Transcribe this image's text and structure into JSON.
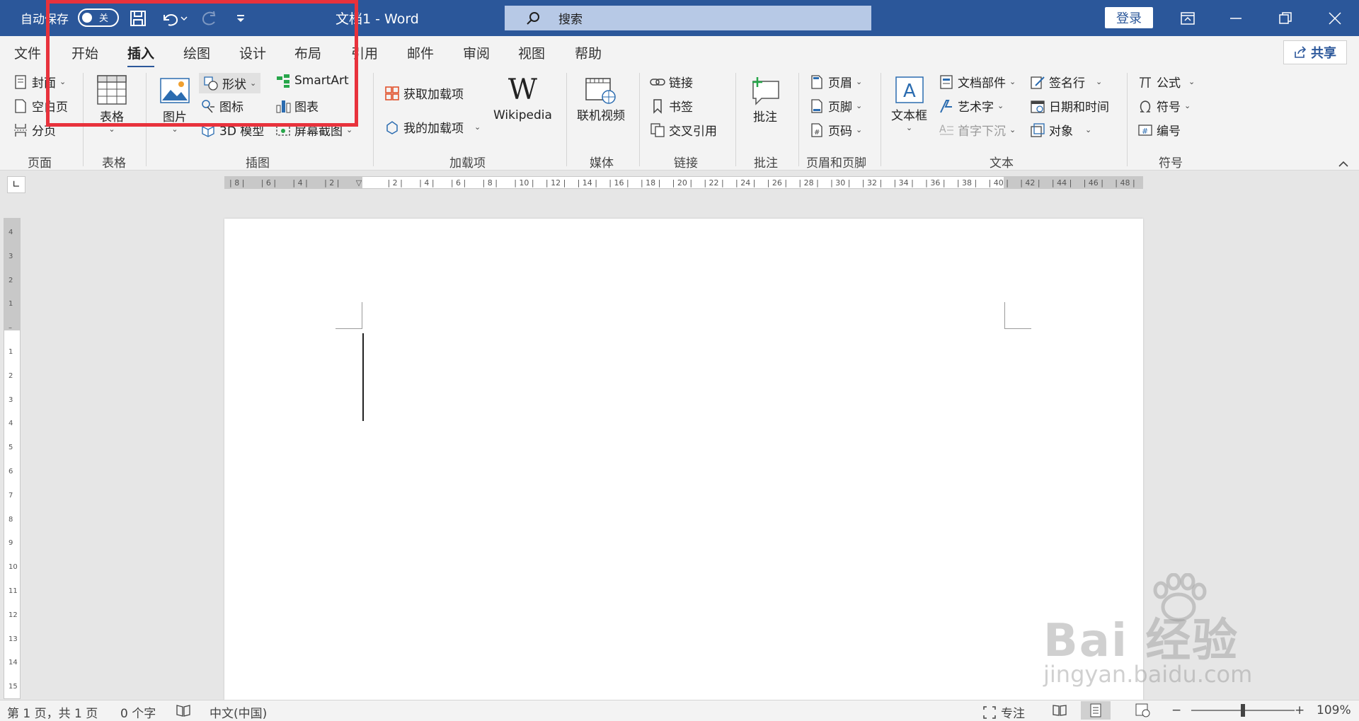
{
  "titlebar": {
    "autosave_label": "自动保存",
    "autosave_state": "关",
    "doc_title": "文档1  -  Word",
    "search_placeholder": "搜索",
    "login_label": "登录"
  },
  "tabs": [
    "文件",
    "开始",
    "插入",
    "绘图",
    "设计",
    "布局",
    "引用",
    "邮件",
    "审阅",
    "视图",
    "帮助"
  ],
  "active_tab": "插入",
  "share_label": "共享",
  "ribbon": {
    "pages": {
      "cover": "封面",
      "blank": "空白页",
      "break": "分页",
      "label": "页面"
    },
    "tables": {
      "table": "表格",
      "label": "表格"
    },
    "illustrations": {
      "picture": "图片",
      "shapes": "形状",
      "icons": "图标",
      "model3d": "3D 模型",
      "smartart": "SmartArt",
      "chart": "图表",
      "screenshot": "屏幕截图",
      "label": "插图"
    },
    "addins": {
      "get": "获取加载项",
      "mine": "我的加载项",
      "wikipedia": "Wikipedia",
      "label": "加载项"
    },
    "media": {
      "video": "联机视频",
      "label": "媒体"
    },
    "links": {
      "link": "链接",
      "bookmark": "书签",
      "crossref": "交叉引用",
      "label": "链接"
    },
    "comments": {
      "comment": "批注",
      "label": "批注"
    },
    "headerfooter": {
      "header": "页眉",
      "footer": "页脚",
      "pagenum": "页码",
      "label": "页眉和页脚"
    },
    "text": {
      "textbox": "文本框",
      "quickparts": "文档部件",
      "wordart": "艺术字",
      "dropcap": "首字下沉",
      "signature": "签名行",
      "datetime": "日期和时间",
      "object": "对象",
      "label": "文本"
    },
    "symbols": {
      "equation": "公式",
      "symbol": "符号",
      "number": "编号",
      "label": "符号"
    }
  },
  "ruler": {
    "labels": [
      "8",
      "6",
      "4",
      "2",
      "",
      "2",
      "4",
      "6",
      "8",
      "10",
      "12",
      "14",
      "16",
      "18",
      "20",
      "22",
      "24",
      "26",
      "28",
      "30",
      "32",
      "34",
      "36",
      "38",
      "40",
      "42",
      "44",
      "46",
      "48"
    ],
    "vlabels": [
      "4",
      "3",
      "2",
      "1",
      "",
      "1",
      "2",
      "3",
      "4",
      "5",
      "6",
      "7",
      "8",
      "9",
      "10",
      "11",
      "12",
      "13",
      "14",
      "15"
    ]
  },
  "status": {
    "page": "第 1 页，共 1 页",
    "words": "0 个字",
    "language": "中文(中国)",
    "focus": "专注",
    "zoom": "109%"
  },
  "watermark": {
    "brand": "Bai 经验",
    "url": "jingyan.baidu.com"
  },
  "colors": {
    "titlebar": "#2b579a",
    "highlight": "#e8323c"
  }
}
